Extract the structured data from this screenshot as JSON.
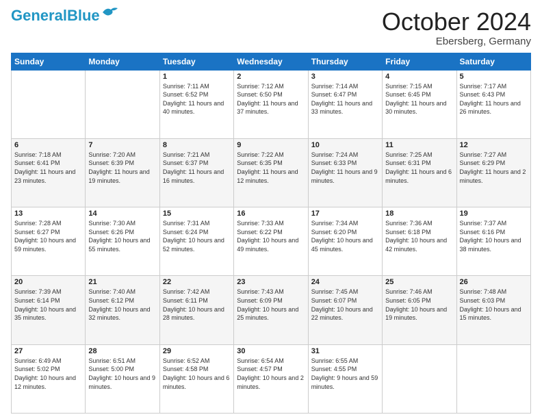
{
  "header": {
    "logo_general": "General",
    "logo_blue": "Blue",
    "month": "October 2024",
    "location": "Ebersberg, Germany"
  },
  "weekdays": [
    "Sunday",
    "Monday",
    "Tuesday",
    "Wednesday",
    "Thursday",
    "Friday",
    "Saturday"
  ],
  "weeks": [
    [
      {
        "day": "",
        "sunrise": "",
        "sunset": "",
        "daylight": ""
      },
      {
        "day": "",
        "sunrise": "",
        "sunset": "",
        "daylight": ""
      },
      {
        "day": "1",
        "sunrise": "Sunrise: 7:11 AM",
        "sunset": "Sunset: 6:52 PM",
        "daylight": "Daylight: 11 hours and 40 minutes."
      },
      {
        "day": "2",
        "sunrise": "Sunrise: 7:12 AM",
        "sunset": "Sunset: 6:50 PM",
        "daylight": "Daylight: 11 hours and 37 minutes."
      },
      {
        "day": "3",
        "sunrise": "Sunrise: 7:14 AM",
        "sunset": "Sunset: 6:47 PM",
        "daylight": "Daylight: 11 hours and 33 minutes."
      },
      {
        "day": "4",
        "sunrise": "Sunrise: 7:15 AM",
        "sunset": "Sunset: 6:45 PM",
        "daylight": "Daylight: 11 hours and 30 minutes."
      },
      {
        "day": "5",
        "sunrise": "Sunrise: 7:17 AM",
        "sunset": "Sunset: 6:43 PM",
        "daylight": "Daylight: 11 hours and 26 minutes."
      }
    ],
    [
      {
        "day": "6",
        "sunrise": "Sunrise: 7:18 AM",
        "sunset": "Sunset: 6:41 PM",
        "daylight": "Daylight: 11 hours and 23 minutes."
      },
      {
        "day": "7",
        "sunrise": "Sunrise: 7:20 AM",
        "sunset": "Sunset: 6:39 PM",
        "daylight": "Daylight: 11 hours and 19 minutes."
      },
      {
        "day": "8",
        "sunrise": "Sunrise: 7:21 AM",
        "sunset": "Sunset: 6:37 PM",
        "daylight": "Daylight: 11 hours and 16 minutes."
      },
      {
        "day": "9",
        "sunrise": "Sunrise: 7:22 AM",
        "sunset": "Sunset: 6:35 PM",
        "daylight": "Daylight: 11 hours and 12 minutes."
      },
      {
        "day": "10",
        "sunrise": "Sunrise: 7:24 AM",
        "sunset": "Sunset: 6:33 PM",
        "daylight": "Daylight: 11 hours and 9 minutes."
      },
      {
        "day": "11",
        "sunrise": "Sunrise: 7:25 AM",
        "sunset": "Sunset: 6:31 PM",
        "daylight": "Daylight: 11 hours and 6 minutes."
      },
      {
        "day": "12",
        "sunrise": "Sunrise: 7:27 AM",
        "sunset": "Sunset: 6:29 PM",
        "daylight": "Daylight: 11 hours and 2 minutes."
      }
    ],
    [
      {
        "day": "13",
        "sunrise": "Sunrise: 7:28 AM",
        "sunset": "Sunset: 6:27 PM",
        "daylight": "Daylight: 10 hours and 59 minutes."
      },
      {
        "day": "14",
        "sunrise": "Sunrise: 7:30 AM",
        "sunset": "Sunset: 6:26 PM",
        "daylight": "Daylight: 10 hours and 55 minutes."
      },
      {
        "day": "15",
        "sunrise": "Sunrise: 7:31 AM",
        "sunset": "Sunset: 6:24 PM",
        "daylight": "Daylight: 10 hours and 52 minutes."
      },
      {
        "day": "16",
        "sunrise": "Sunrise: 7:33 AM",
        "sunset": "Sunset: 6:22 PM",
        "daylight": "Daylight: 10 hours and 49 minutes."
      },
      {
        "day": "17",
        "sunrise": "Sunrise: 7:34 AM",
        "sunset": "Sunset: 6:20 PM",
        "daylight": "Daylight: 10 hours and 45 minutes."
      },
      {
        "day": "18",
        "sunrise": "Sunrise: 7:36 AM",
        "sunset": "Sunset: 6:18 PM",
        "daylight": "Daylight: 10 hours and 42 minutes."
      },
      {
        "day": "19",
        "sunrise": "Sunrise: 7:37 AM",
        "sunset": "Sunset: 6:16 PM",
        "daylight": "Daylight: 10 hours and 38 minutes."
      }
    ],
    [
      {
        "day": "20",
        "sunrise": "Sunrise: 7:39 AM",
        "sunset": "Sunset: 6:14 PM",
        "daylight": "Daylight: 10 hours and 35 minutes."
      },
      {
        "day": "21",
        "sunrise": "Sunrise: 7:40 AM",
        "sunset": "Sunset: 6:12 PM",
        "daylight": "Daylight: 10 hours and 32 minutes."
      },
      {
        "day": "22",
        "sunrise": "Sunrise: 7:42 AM",
        "sunset": "Sunset: 6:11 PM",
        "daylight": "Daylight: 10 hours and 28 minutes."
      },
      {
        "day": "23",
        "sunrise": "Sunrise: 7:43 AM",
        "sunset": "Sunset: 6:09 PM",
        "daylight": "Daylight: 10 hours and 25 minutes."
      },
      {
        "day": "24",
        "sunrise": "Sunrise: 7:45 AM",
        "sunset": "Sunset: 6:07 PM",
        "daylight": "Daylight: 10 hours and 22 minutes."
      },
      {
        "day": "25",
        "sunrise": "Sunrise: 7:46 AM",
        "sunset": "Sunset: 6:05 PM",
        "daylight": "Daylight: 10 hours and 19 minutes."
      },
      {
        "day": "26",
        "sunrise": "Sunrise: 7:48 AM",
        "sunset": "Sunset: 6:03 PM",
        "daylight": "Daylight: 10 hours and 15 minutes."
      }
    ],
    [
      {
        "day": "27",
        "sunrise": "Sunrise: 6:49 AM",
        "sunset": "Sunset: 5:02 PM",
        "daylight": "Daylight: 10 hours and 12 minutes."
      },
      {
        "day": "28",
        "sunrise": "Sunrise: 6:51 AM",
        "sunset": "Sunset: 5:00 PM",
        "daylight": "Daylight: 10 hours and 9 minutes."
      },
      {
        "day": "29",
        "sunrise": "Sunrise: 6:52 AM",
        "sunset": "Sunset: 4:58 PM",
        "daylight": "Daylight: 10 hours and 6 minutes."
      },
      {
        "day": "30",
        "sunrise": "Sunrise: 6:54 AM",
        "sunset": "Sunset: 4:57 PM",
        "daylight": "Daylight: 10 hours and 2 minutes."
      },
      {
        "day": "31",
        "sunrise": "Sunrise: 6:55 AM",
        "sunset": "Sunset: 4:55 PM",
        "daylight": "Daylight: 9 hours and 59 minutes."
      },
      {
        "day": "",
        "sunrise": "",
        "sunset": "",
        "daylight": ""
      },
      {
        "day": "",
        "sunrise": "",
        "sunset": "",
        "daylight": ""
      }
    ]
  ]
}
